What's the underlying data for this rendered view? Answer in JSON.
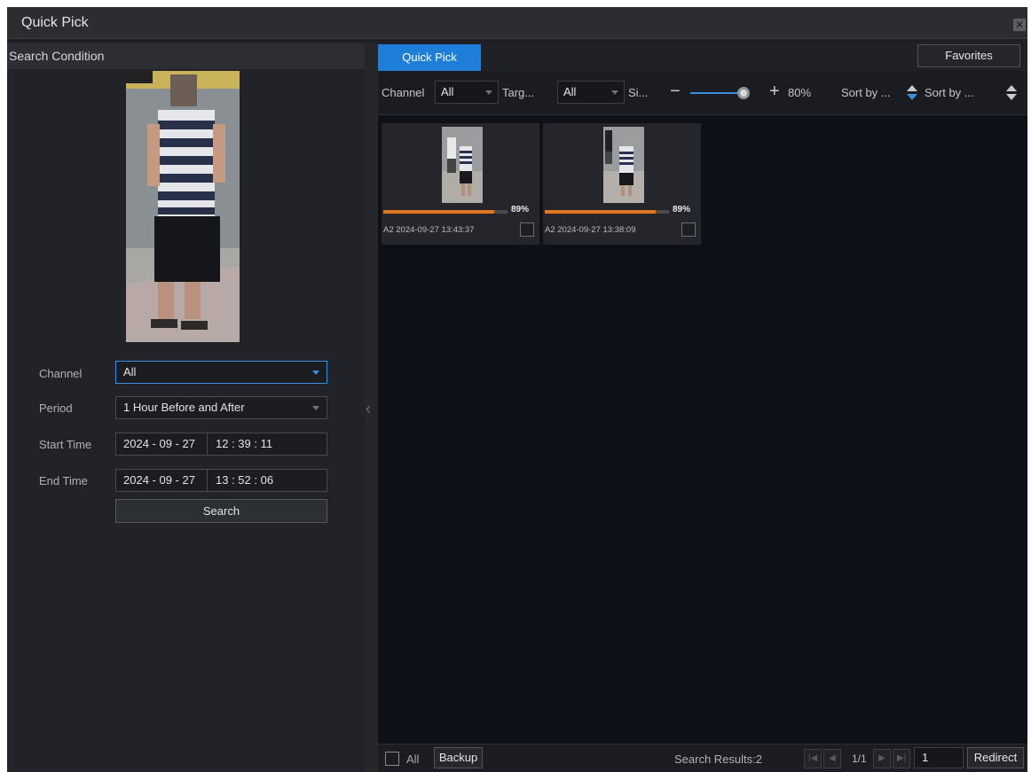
{
  "window": {
    "title": "Quick Pick",
    "close_glyph": "✕"
  },
  "left": {
    "header": "Search Condition",
    "channel": {
      "label": "Channel",
      "value": "All"
    },
    "period": {
      "label": "Period",
      "value": "1 Hour Before and After"
    },
    "start": {
      "label": "Start Time",
      "date": "2024 - 09 - 27",
      "time": "12 : 39 : 11"
    },
    "end": {
      "label": "End Time",
      "date": "2024 - 09 - 27",
      "time": "13 : 52 : 06"
    },
    "search_label": "Search"
  },
  "right": {
    "tab_label": "Quick Pick",
    "favorites_label": "Favorites",
    "filters": {
      "channel_label": "Channel",
      "channel_value": "All",
      "target_label": "Targ...",
      "target_value": "All",
      "similarity_label": "Si...",
      "zoom_minus": "−",
      "zoom_plus": "+",
      "zoom_value": "80%",
      "sort1_label": "Sort by ...",
      "sort2_label": "Sort by ..."
    },
    "results": [
      {
        "similarity": "89%",
        "similarity_fraction": 0.89,
        "caption": "A2 2024-09-27 13:43:37"
      },
      {
        "similarity": "89%",
        "similarity_fraction": 0.89,
        "caption": "A2 2024-09-27 13:38:09"
      }
    ],
    "bottom": {
      "all_label": "All",
      "backup_label": "Backup",
      "results_text": "Search Results:2",
      "page_info": "1/1",
      "page_input": "1",
      "redirect_label": "Redirect"
    }
  },
  "colors": {
    "accent": "#1f7fd8",
    "similarity_bar": "#e2771f"
  }
}
